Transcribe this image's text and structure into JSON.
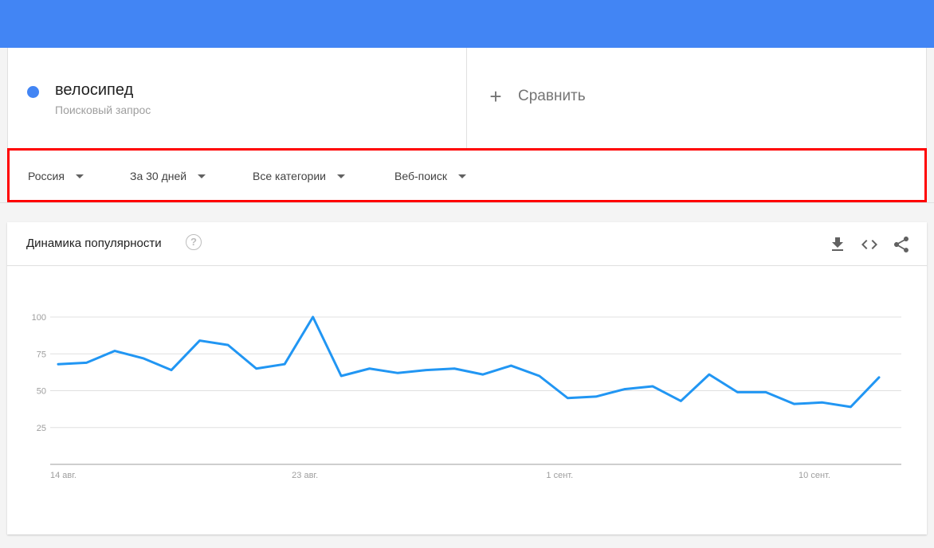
{
  "search_term": {
    "name": "велосипед",
    "subtitle": "Поисковый запрос",
    "dot_color": "#4285f4"
  },
  "compare": {
    "label": "Сравнить",
    "icon": "plus-icon"
  },
  "filters": [
    {
      "label": "Россия",
      "icon": "caret-down-icon"
    },
    {
      "label": "За 30 дней",
      "icon": "caret-down-icon"
    },
    {
      "label": "Все категории",
      "icon": "caret-down-icon"
    },
    {
      "label": "Веб-поиск",
      "icon": "caret-down-icon"
    }
  ],
  "chart_card": {
    "title": "Динамика популярности",
    "help_icon": "?",
    "tools": [
      "download-icon",
      "embed-code-icon",
      "share-icon"
    ]
  },
  "chart_data": {
    "type": "line",
    "title": "",
    "xlabel": "",
    "ylabel": "",
    "ylim": [
      0,
      100
    ],
    "y_ticks": [
      100,
      75,
      50,
      25
    ],
    "grid": true,
    "x_tick_labels": [
      {
        "index": 0,
        "label": "14 авг."
      },
      {
        "index": 9,
        "label": "23 авг."
      },
      {
        "index": 18,
        "label": "1 сент."
      },
      {
        "index": 27,
        "label": "10 сент."
      }
    ],
    "series": [
      {
        "color": "#2196f3",
        "values": [
          68,
          69,
          77,
          72,
          64,
          84,
          81,
          65,
          68,
          100,
          60,
          65,
          62,
          64,
          65,
          61,
          67,
          60,
          45,
          46,
          51,
          53,
          43,
          61,
          49,
          49,
          41,
          42,
          39,
          59
        ]
      }
    ]
  }
}
